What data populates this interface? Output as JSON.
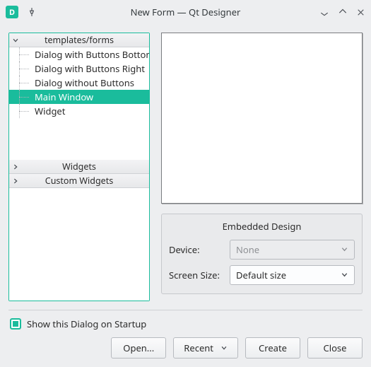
{
  "titlebar": {
    "title": "New Form — Qt Designer"
  },
  "tree": {
    "groups": {
      "templates_label": "templates/forms",
      "widgets_label": "Widgets",
      "custom_widgets_label": "Custom Widgets"
    },
    "templates_items": [
      "Dialog with Buttons Bottom",
      "Dialog with Buttons Right",
      "Dialog without Buttons",
      "Main Window",
      "Widget"
    ],
    "selected_index": 3
  },
  "embedded": {
    "title": "Embedded Design",
    "device_label": "Device:",
    "device_value": "None",
    "screen_label": "Screen Size:",
    "screen_value": "Default size"
  },
  "startup": {
    "label": "Show this Dialog on Startup",
    "checked": true
  },
  "buttons": {
    "open": "Open...",
    "recent": "Recent",
    "create": "Create",
    "close": "Close"
  }
}
